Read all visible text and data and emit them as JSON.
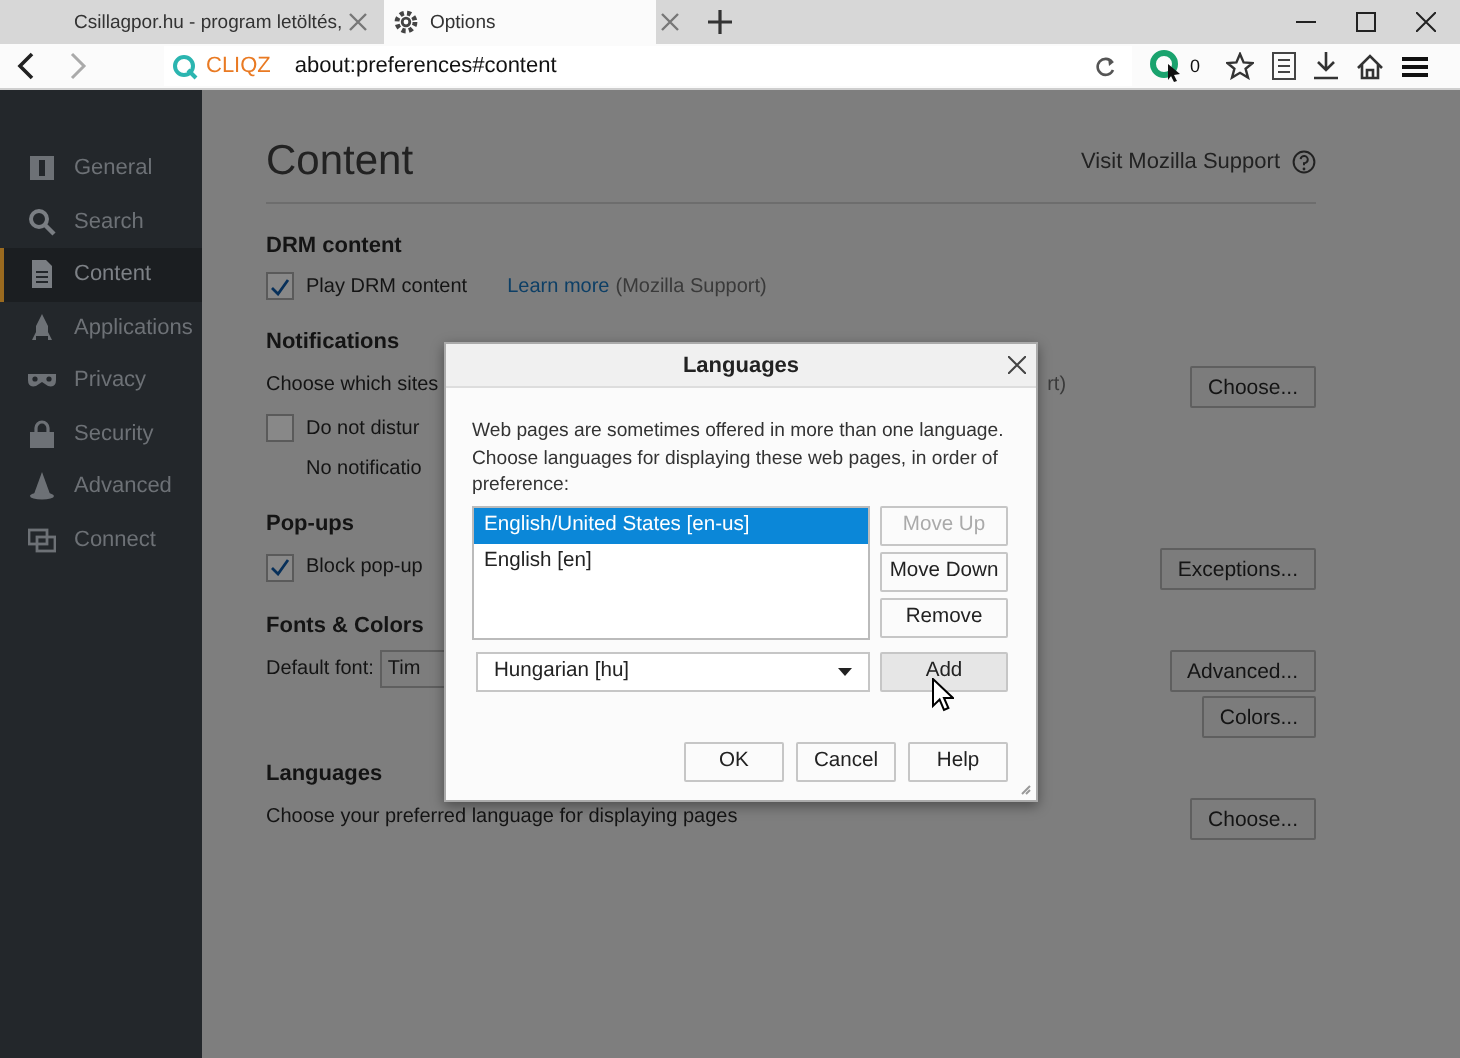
{
  "tabs": [
    {
      "title": "Csillagpor.hu - program letöltés,",
      "selected": false
    },
    {
      "title": "Options",
      "selected": true
    }
  ],
  "toolbar": {
    "brand": "CLIQZ",
    "url": "about:preferences#content",
    "badge": "0"
  },
  "sidebar": {
    "items": [
      {
        "label": "General",
        "selected": false
      },
      {
        "label": "Search",
        "selected": false
      },
      {
        "label": "Content",
        "selected": true
      },
      {
        "label": "Applications",
        "selected": false
      },
      {
        "label": "Privacy",
        "selected": false
      },
      {
        "label": "Security",
        "selected": false
      },
      {
        "label": "Advanced",
        "selected": false
      },
      {
        "label": "Connect",
        "selected": false
      }
    ]
  },
  "page": {
    "title": "Content",
    "support_link": "Visit Mozilla Support",
    "sections": [
      {
        "heading": "DRM content",
        "rows": [
          {
            "kind": "checkbox",
            "label": "Play DRM content",
            "checked": true,
            "link": "Learn more",
            "note": "(Mozilla Support)"
          }
        ]
      },
      {
        "heading": "Notifications",
        "rows": [
          {
            "kind": "text",
            "text": "Choose which sites",
            "tail": "rt)",
            "button": "Choose..."
          },
          {
            "kind": "checkbox",
            "label": "Do not distur",
            "checked": false
          },
          {
            "kind": "note",
            "text": "No notificatio"
          }
        ]
      },
      {
        "heading": "Pop-ups",
        "rows": [
          {
            "kind": "checkbox",
            "label": "Block pop-up",
            "checked": true,
            "button": "Exceptions..."
          }
        ]
      },
      {
        "heading": "Fonts & Colors",
        "rows": [
          {
            "kind": "font",
            "label": "Default font:",
            "value": "Tim",
            "button": "Advanced..."
          },
          {
            "kind": "text",
            "button": "Colors..."
          }
        ]
      },
      {
        "heading": "Languages",
        "rows": [
          {
            "kind": "text",
            "text": "Choose your preferred language for displaying pages",
            "button": "Choose..."
          }
        ]
      }
    ]
  },
  "dialog": {
    "title": "Languages",
    "description": "Web pages are sometimes offered in more than one language. Choose languages for displaying these web pages, in order of preference:",
    "languages": [
      {
        "label": "English/United States  [en-us]",
        "selected": true
      },
      {
        "label": "English  [en]",
        "selected": false
      }
    ],
    "side_buttons": [
      {
        "label": "Move Up",
        "disabled": true
      },
      {
        "label": "Move Down",
        "disabled": false
      },
      {
        "label": "Remove",
        "disabled": false
      }
    ],
    "select": {
      "value": "Hungarian  [hu]"
    },
    "add_button": "Add",
    "buttons": [
      "OK",
      "Cancel",
      "Help"
    ]
  }
}
